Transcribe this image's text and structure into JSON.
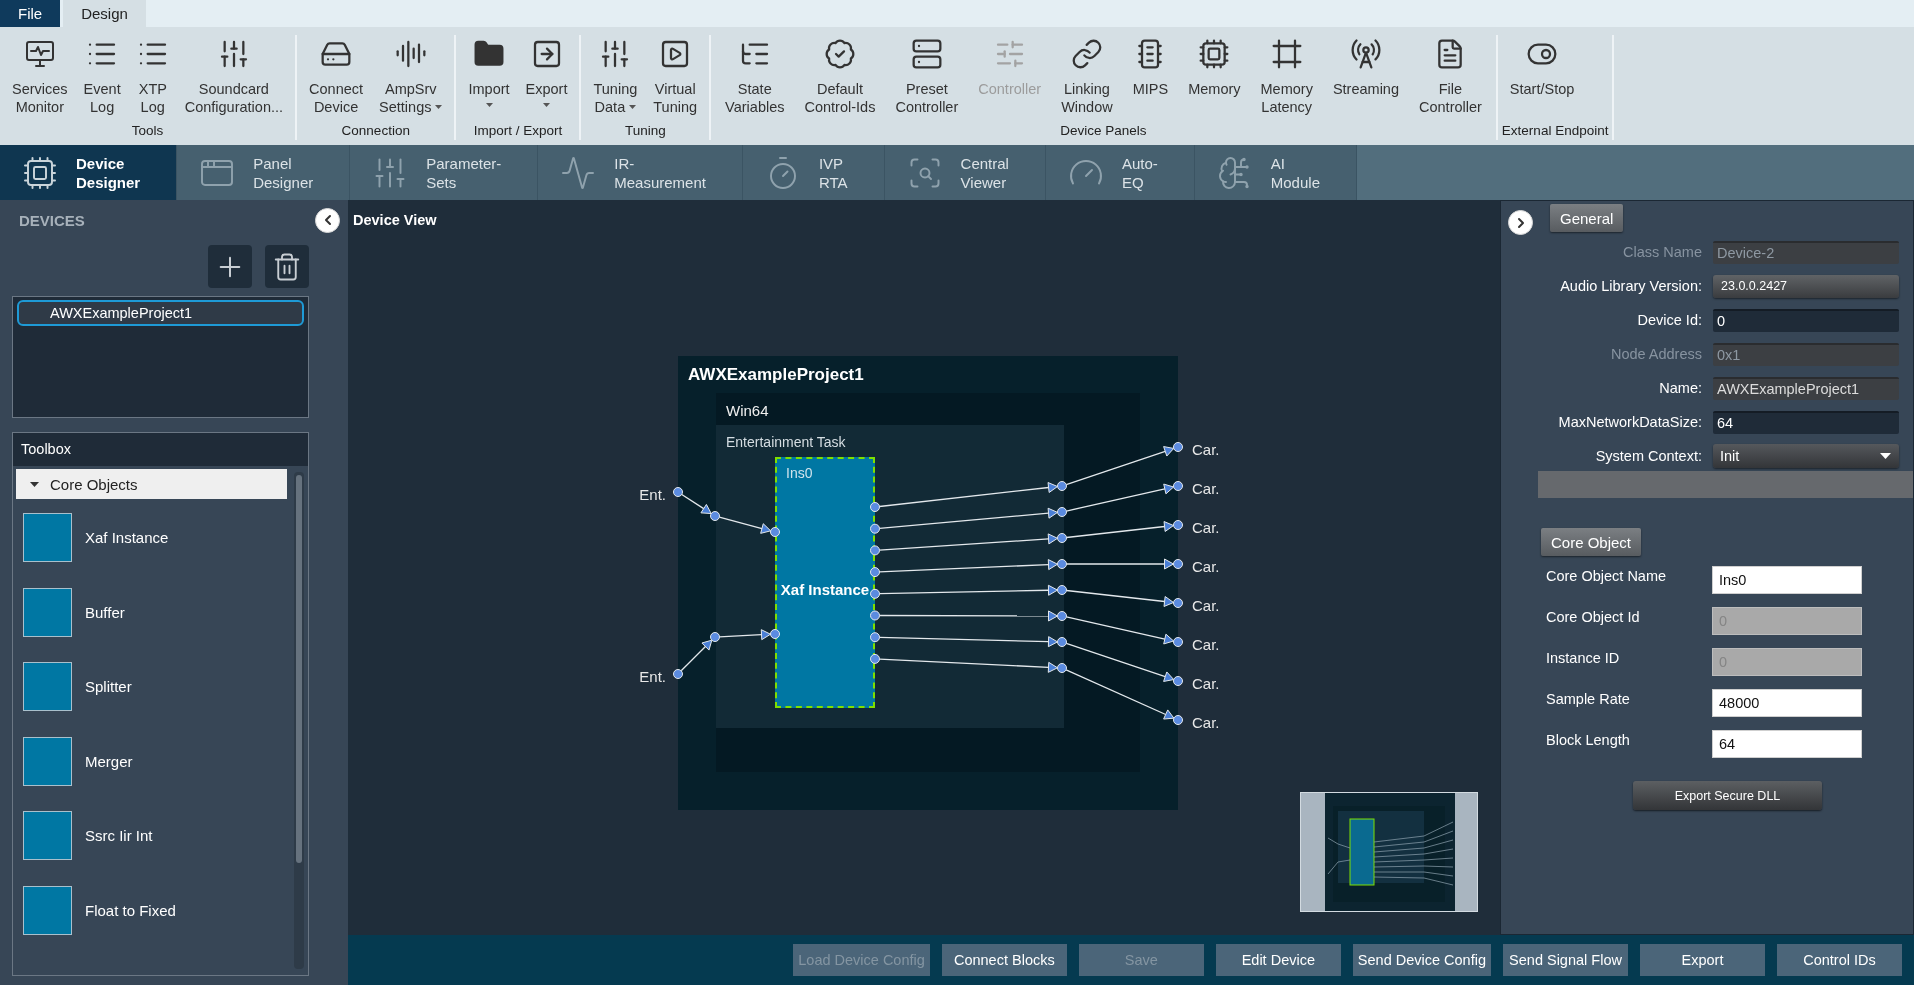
{
  "menu_tabs": [
    {
      "label": "File",
      "kind": "file",
      "selected": false
    },
    {
      "label": "Design",
      "kind": "tab",
      "selected": true
    }
  ],
  "ribbon": {
    "groups": [
      {
        "label": "Tools",
        "buttons": [
          {
            "label": "Services Monitor",
            "kind": "button",
            "disabled": false
          },
          {
            "label": "Event Log",
            "kind": "button",
            "disabled": false
          },
          {
            "label": "XTP Log",
            "kind": "button",
            "disabled": false
          },
          {
            "label": "Soundcard Configuration...",
            "kind": "button",
            "disabled": false
          }
        ]
      },
      {
        "label": "Connection",
        "buttons": [
          {
            "label": "Connect Device",
            "kind": "button",
            "disabled": false
          },
          {
            "label": "AmpSrv Settings",
            "kind": "menu",
            "disabled": false
          }
        ]
      },
      {
        "label": "Import / Export",
        "buttons": [
          {
            "label": "Import",
            "kind": "split",
            "disabled": false
          },
          {
            "label": "Export",
            "kind": "split",
            "disabled": false
          }
        ]
      },
      {
        "label": "Tuning",
        "buttons": [
          {
            "label": "Tuning Data",
            "kind": "menu",
            "disabled": false
          },
          {
            "label": "Virtual Tuning",
            "kind": "button",
            "disabled": false
          }
        ]
      },
      {
        "label": "Device Panels",
        "buttons": [
          {
            "label": "State Variables",
            "kind": "button",
            "disabled": false
          },
          {
            "label": "Default Control-Ids",
            "kind": "button",
            "disabled": false
          },
          {
            "label": "Preset Controller",
            "kind": "button",
            "disabled": false
          },
          {
            "label": "Controller",
            "kind": "button",
            "disabled": true
          },
          {
            "label": "Linking Window",
            "kind": "button",
            "disabled": false
          },
          {
            "label": "MIPS",
            "kind": "button",
            "disabled": false
          },
          {
            "label": "Memory",
            "kind": "button",
            "disabled": false
          },
          {
            "label": "Memory Latency",
            "kind": "button",
            "disabled": false
          },
          {
            "label": "Streaming",
            "kind": "button",
            "disabled": false
          },
          {
            "label": "File Controller",
            "kind": "button",
            "disabled": false
          }
        ]
      },
      {
        "label": "External Endpoint",
        "buttons": [
          {
            "label": "Start/Stop",
            "kind": "button",
            "disabled": false
          }
        ]
      }
    ]
  },
  "module_tabs": [
    {
      "label": "Device Designer",
      "selected": true
    },
    {
      "label": "Panel Designer",
      "selected": false
    },
    {
      "label": "Parameter-Sets",
      "selected": false
    },
    {
      "label": "IR-Measurement",
      "selected": false
    },
    {
      "label": "IVP RTA",
      "selected": false
    },
    {
      "label": "Central Viewer",
      "selected": false
    },
    {
      "label": "Auto-EQ",
      "selected": false
    },
    {
      "label": "AI Module",
      "selected": false
    }
  ],
  "devices": {
    "title": "DEVICES",
    "items": [
      {
        "name": "AWXExampleProject1",
        "selected": true
      }
    ]
  },
  "toolbox": {
    "title": "Toolbox",
    "category": {
      "label": "Core Objects",
      "expanded": true
    },
    "items": [
      {
        "label": "Xaf Instance"
      },
      {
        "label": "Buffer"
      },
      {
        "label": "Splitter"
      },
      {
        "label": "Merger"
      },
      {
        "label": "Ssrc Iir Int"
      },
      {
        "label": "Float to Fixed"
      }
    ]
  },
  "canvas": {
    "title": "Device View",
    "device": {
      "name": "AWXExampleProject1",
      "platform": {
        "name": "Win64",
        "task": {
          "name": "Entertainment Task",
          "block": {
            "id": "Ins0",
            "type": "Xaf Instance",
            "selected": true
          }
        }
      }
    },
    "inputs": [
      {
        "label": "Ent."
      },
      {
        "label": "Ent."
      }
    ],
    "outputs": [
      {
        "label": "Car."
      },
      {
        "label": "Car."
      },
      {
        "label": "Car."
      },
      {
        "label": "Car."
      },
      {
        "label": "Car."
      },
      {
        "label": "Car."
      },
      {
        "label": "Car."
      },
      {
        "label": "Car."
      }
    ]
  },
  "properties": {
    "general": {
      "title": "General",
      "rows": [
        {
          "label": "Class Name",
          "value": "Device-2",
          "kind": "readonly",
          "disabled": true
        },
        {
          "label": "Audio Library Version:",
          "value": "23.0.0.2427",
          "kind": "button",
          "disabled": false
        },
        {
          "label": "Device Id:",
          "value": "0",
          "kind": "text",
          "disabled": false
        },
        {
          "label": "Node Address",
          "value": "0x1",
          "kind": "readonly",
          "disabled": true
        },
        {
          "label": "Name:",
          "value": "AWXExampleProject1",
          "kind": "readonly",
          "disabled": false
        },
        {
          "label": "MaxNetworkDataSize:",
          "value": "64",
          "kind": "text",
          "disabled": false
        },
        {
          "label": "System Context:",
          "value": "Init",
          "kind": "dropdown",
          "disabled": false
        }
      ]
    },
    "core_object": {
      "title": "Core Object",
      "rows": [
        {
          "label": "Core Object Name",
          "value": "Ins0",
          "disabled": false
        },
        {
          "label": "Core Object Id",
          "value": "0",
          "disabled": true
        },
        {
          "label": "Instance ID",
          "value": "0",
          "disabled": true
        },
        {
          "label": "Sample Rate",
          "value": "48000",
          "disabled": false
        },
        {
          "label": "Block Length",
          "value": "64",
          "disabled": false
        }
      ],
      "button": "Export Secure DLL"
    }
  },
  "action_buttons": [
    {
      "label": "Load Device Config",
      "disabled": true
    },
    {
      "label": "Connect Blocks",
      "disabled": false
    },
    {
      "label": "Save",
      "disabled": true
    },
    {
      "label": "Edit Device",
      "disabled": false
    },
    {
      "label": "Send Device Config",
      "disabled": false
    },
    {
      "label": "Send Signal Flow",
      "disabled": false
    },
    {
      "label": "Export",
      "disabled": false
    },
    {
      "label": "Control IDs",
      "disabled": false
    }
  ]
}
